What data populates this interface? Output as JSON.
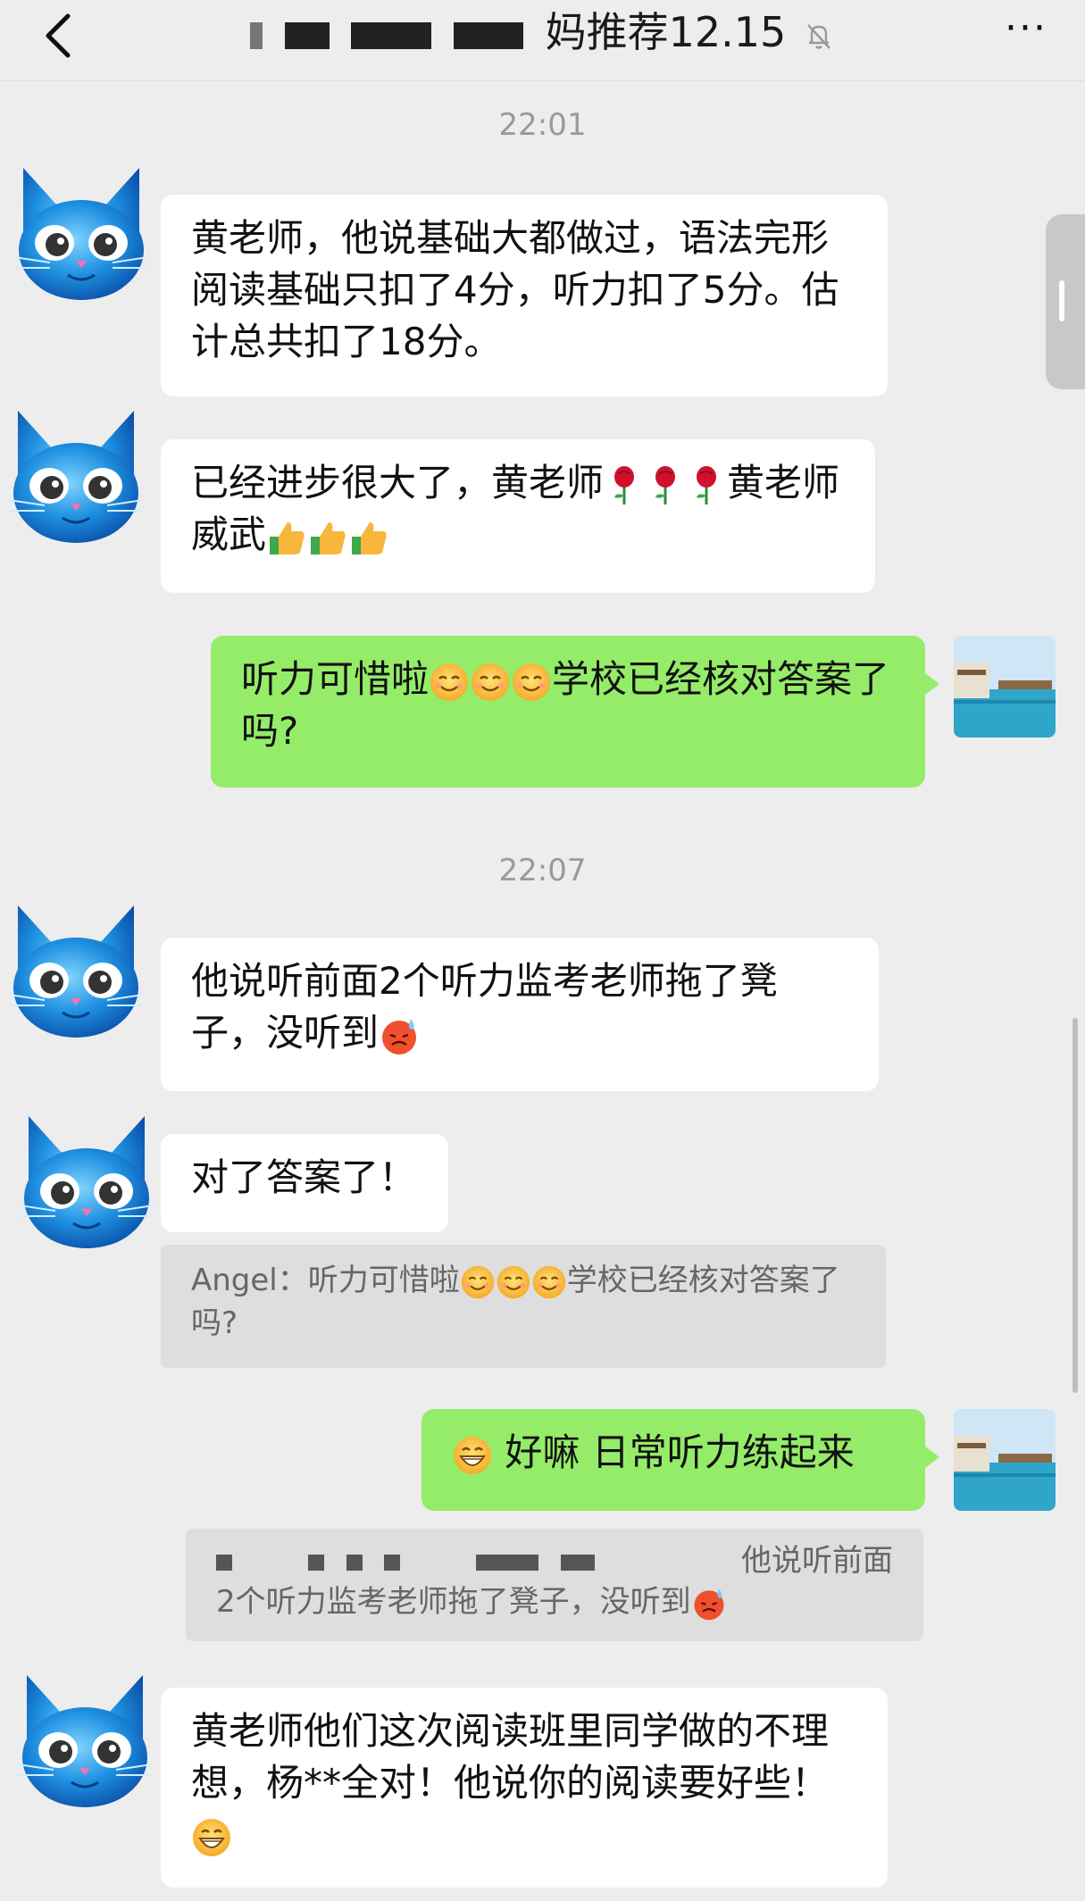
{
  "header": {
    "title_visible": "妈推荐12.15",
    "more_label": "···"
  },
  "timestamps": [
    "22:01",
    "22:07"
  ],
  "messages": [
    {
      "text": "黄老师，他说基础大都做过，语法完形阅读基础只扣了4分，听力扣了5分。估计总共扣了18分。"
    },
    {
      "text_a": "已经进步很大了，黄老师",
      "text_b": "黄老师威武"
    },
    {
      "text_a": "听力可惜啦",
      "text_b": "学校已经核对答案了吗?"
    },
    {
      "text": "他说听前面2个听力监考老师拖了凳子，没听到"
    },
    {
      "text": "对了答案了！"
    },
    {
      "quote_a": "Angel：听力可惜啦",
      "quote_b": "学校已经核对答案了吗?"
    },
    {
      "text": "好嘛 日常听力练起来"
    },
    {
      "quote_head": "他说听前面",
      "quote_body": "2个听力监考老师拖了凳子，没听到"
    },
    {
      "text": "黄老师他们这次阅读班里同学做的不理想，杨**全对！他说你的阅读要好些！"
    }
  ],
  "colors": {
    "background": "#ededed",
    "outgoing": "#95ec69",
    "incoming": "#ffffff",
    "quote": "#dedede"
  }
}
